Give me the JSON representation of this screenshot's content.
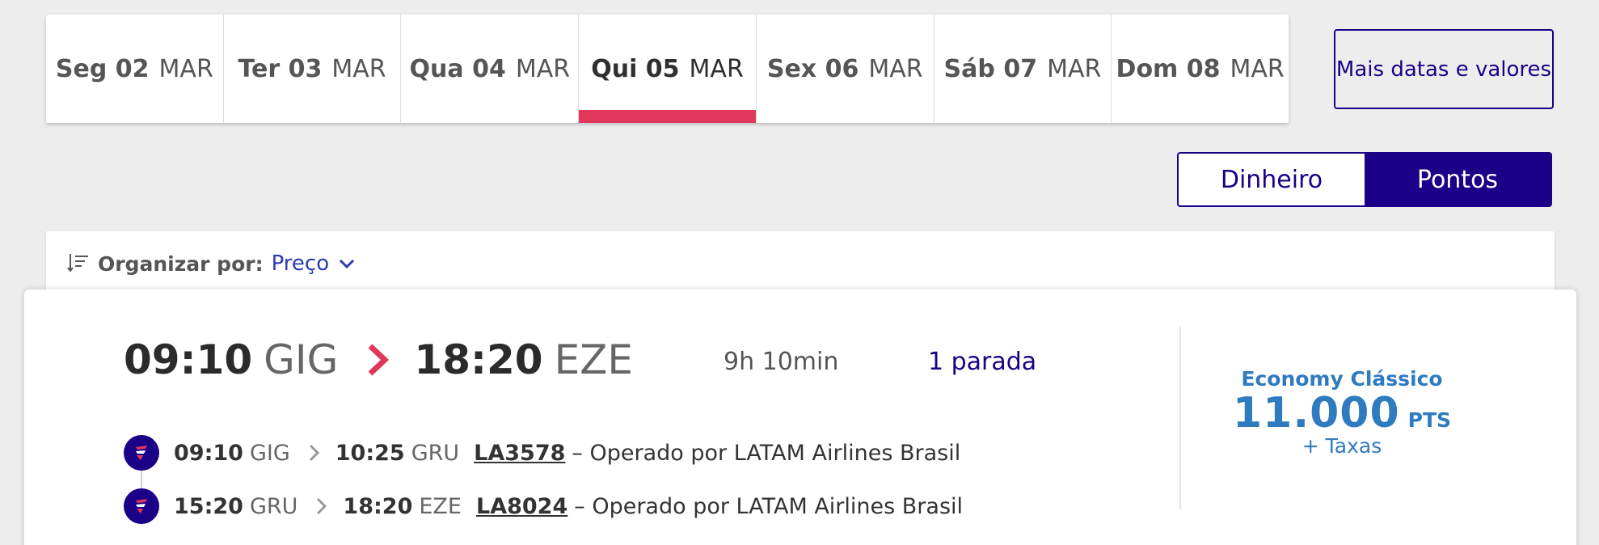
{
  "date_tabs": [
    {
      "day": "Seg 02",
      "month": "MAR",
      "selected": false
    },
    {
      "day": "Ter 03",
      "month": "MAR",
      "selected": false
    },
    {
      "day": "Qua 04",
      "month": "MAR",
      "selected": false
    },
    {
      "day": "Qui 05",
      "month": "MAR",
      "selected": true
    },
    {
      "day": "Sex 06",
      "month": "MAR",
      "selected": false
    },
    {
      "day": "Sáb 07",
      "month": "MAR",
      "selected": false
    },
    {
      "day": "Dom 08",
      "month": "MAR",
      "selected": false
    }
  ],
  "more_dates_label": "Mais datas e valores",
  "currency_toggle": {
    "options": [
      "Dinheiro",
      "Pontos"
    ],
    "selected": "Pontos"
  },
  "sort": {
    "label": "Organizar por:",
    "value": "Preço",
    "icon": "sort-icon"
  },
  "flight": {
    "departure_time": "09:10",
    "origin": "GIG",
    "arrival_time": "18:20",
    "destination": "EZE",
    "duration": "9h 10min",
    "stops": "1 parada",
    "segments": [
      {
        "dep_time": "09:10",
        "dep_airport": "GIG",
        "arr_time": "10:25",
        "arr_airport": "GRU",
        "flight_number": "LA3578",
        "operator": "– Operado por LATAM Airlines Brasil"
      },
      {
        "dep_time": "15:20",
        "dep_airport": "GRU",
        "arr_time": "18:20",
        "arr_airport": "EZE",
        "flight_number": "LA8024",
        "operator": "– Operado por LATAM Airlines Brasil"
      }
    ],
    "fare": {
      "cabin": "Economy Clássico",
      "points": "11.000",
      "unit": "PTS",
      "taxes": "+ Taxas"
    }
  },
  "colors": {
    "brand_navy": "#1b0088",
    "accent_red": "#e0375a",
    "fare_blue": "#2f7bc0"
  }
}
